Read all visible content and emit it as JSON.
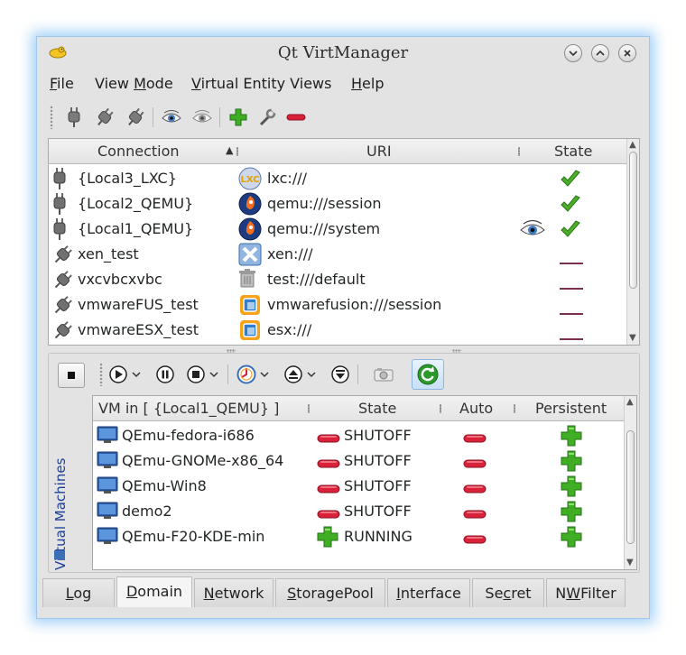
{
  "window": {
    "title": "Qt VirtManager"
  },
  "menu": [
    {
      "pre": "",
      "key": "F",
      "post": "ile"
    },
    {
      "pre": "View ",
      "key": "M",
      "post": "ode"
    },
    {
      "pre": "",
      "key": "V",
      "post": "irtual Entity Views"
    },
    {
      "pre": "",
      "key": "H",
      "post": "elp"
    }
  ],
  "connections": {
    "headers": {
      "connection": "Connection",
      "uri": "URI",
      "state": "State"
    },
    "rows": [
      {
        "name": "{Local3_LXC}",
        "uri": "lxc:///",
        "driver": "lxc",
        "connected": true,
        "watched": false,
        "state": "ok"
      },
      {
        "name": "{Local2_QEMU}",
        "uri": "qemu:///session",
        "driver": "qemu",
        "connected": true,
        "watched": false,
        "state": "ok"
      },
      {
        "name": "{Local1_QEMU}",
        "uri": "qemu:///system",
        "driver": "qemu",
        "connected": true,
        "watched": true,
        "state": "ok"
      },
      {
        "name": "xen_test",
        "uri": "xen:///",
        "driver": "xen",
        "connected": false,
        "watched": false,
        "state": "none"
      },
      {
        "name": "vxcvbcxvbc",
        "uri": "test:///default",
        "driver": "test",
        "connected": false,
        "watched": false,
        "state": "none"
      },
      {
        "name": "vmwareFUS_test",
        "uri": "vmwarefusion:///session",
        "driver": "vmware",
        "connected": false,
        "watched": false,
        "state": "none"
      },
      {
        "name": "vmwareESX_test",
        "uri": "esx:///",
        "driver": "vmware",
        "connected": false,
        "watched": false,
        "state": "none"
      }
    ]
  },
  "vm_panel": {
    "side_label": "Virtual Machines",
    "headers": {
      "name": "VM in [ {Local1_QEMU} ]",
      "state": "State",
      "auto": "Auto",
      "persistent": "Persistent"
    },
    "rows": [
      {
        "name": "QEmu-fedora-i686",
        "state": "SHUTOFF",
        "running": false
      },
      {
        "name": "QEmu-GNOMe-x86_64",
        "state": "SHUTOFF",
        "running": false
      },
      {
        "name": "QEmu-Win8",
        "state": "SHUTOFF",
        "running": false
      },
      {
        "name": "demo2",
        "state": "SHUTOFF",
        "running": false
      },
      {
        "name": "QEmu-F20-KDE-min",
        "state": "RUNNING",
        "running": true
      }
    ]
  },
  "tabs": [
    {
      "pre": "",
      "key": "L",
      "post": "og",
      "active": false
    },
    {
      "pre": "",
      "key": "D",
      "post": "omain",
      "active": true
    },
    {
      "pre": "",
      "key": "N",
      "post": "etwork",
      "active": false
    },
    {
      "pre": "",
      "key": "S",
      "post": "toragePool",
      "active": false
    },
    {
      "pre": "",
      "key": "I",
      "post": "nterface",
      "active": false
    },
    {
      "pre": "Se",
      "key": "c",
      "post": "ret",
      "active": false
    },
    {
      "pre": "N",
      "key": "W",
      "post": "Filter",
      "active": false
    }
  ],
  "colors": {
    "accent": "#3daee9",
    "ok_green": "#4caf2a",
    "stop_red": "#d9223a"
  }
}
